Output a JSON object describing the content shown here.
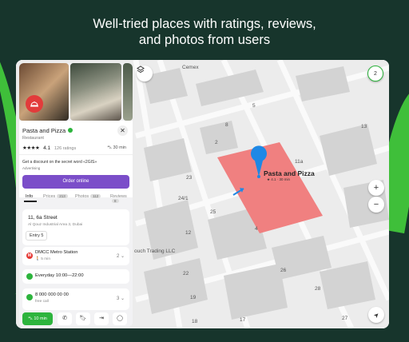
{
  "headline": {
    "line1": "Well-tried places with ratings, reviews,",
    "line2": "and photos from users"
  },
  "map": {
    "labels": {
      "cemex": "Cemex",
      "n2": "2",
      "n5": "5",
      "n8": "8",
      "n13": "13",
      "n23": "23",
      "n241": "24/1",
      "n25": "25",
      "n11a": "11a",
      "n4": "4",
      "n12": "12",
      "n26": "26",
      "n28": "28",
      "n27": "27",
      "n17": "17",
      "n22": "22",
      "n19": "19",
      "n18": "18",
      "trading": "ouch Trading LLC"
    },
    "poi_name": "Pasta and Pizza",
    "poi_sub": "★ 4.1 · 30 min",
    "layer_label": "2",
    "zoom_in": "+",
    "zoom_out": "−",
    "locate": "➤"
  },
  "panel": {
    "title": "Pasta and Pizza",
    "category": "Restaurant",
    "stars": "★★★★",
    "rating": "4.1",
    "ratings_count": "126 ratings",
    "travel_time": "30 min",
    "promo": "Get a discount on the secret word «2GIS»",
    "promo_tag": "Advertising",
    "order_label": "Order online",
    "tabs": [
      {
        "label": "Info"
      },
      {
        "label": "Prices",
        "count": "213"
      },
      {
        "label": "Photos",
        "count": "112"
      },
      {
        "label": "Reviews",
        "count": "8"
      }
    ],
    "address": "11, 6a Street",
    "address_sub": "Al Qouz Industrial Area 3, Dubai",
    "entry": "Entry 5",
    "metro_name": "DMCC Metro Station",
    "metro_sub": "🚶 5 min",
    "metro_count": "2",
    "metro_icon": "M",
    "hours": "Everyday 10:00—22:00",
    "phone": "8 000 000 00 00",
    "phone_sub": "free call",
    "phone_count": "3",
    "route_label": "10 min",
    "close": "✕",
    "chevron": "⌄"
  },
  "colors": {
    "accent": "#7b4ec9",
    "green": "#2db43d",
    "poi": "#f08080",
    "pin": "#1e88e5"
  }
}
